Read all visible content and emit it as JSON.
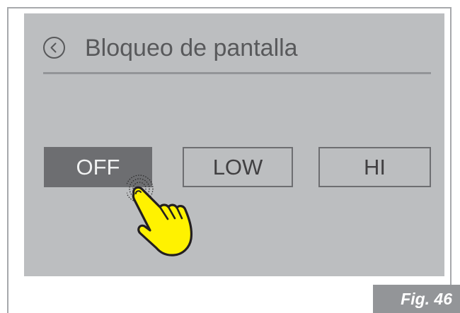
{
  "header": {
    "title": "Bloqueo de pantalla",
    "back_icon": "chevron-left-circle-icon"
  },
  "options": [
    {
      "label": "OFF",
      "selected": true
    },
    {
      "label": "LOW",
      "selected": false
    },
    {
      "label": "HI",
      "selected": false
    }
  ],
  "pointer_icon": "tapping-hand-icon",
  "figure": {
    "label": "Fig. 46"
  },
  "colors": {
    "screen_background": "#bcbec0",
    "selected_option": "#6d6e71",
    "hand_fill": "#fff200",
    "figure_badge": "#939598"
  }
}
